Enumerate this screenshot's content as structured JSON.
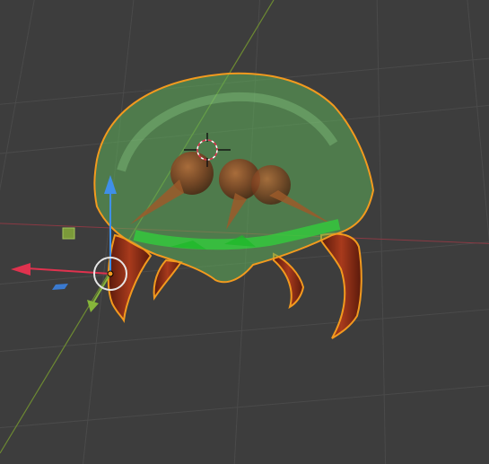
{
  "viewport": {
    "view": "3D Viewport",
    "background_color": "#3d3d3d",
    "grid_color": "#4a4a4a"
  },
  "axes": {
    "x_color": "#e0324e",
    "y_color": "#86b63a",
    "z_color": "#3f8fe8"
  },
  "object": {
    "selected": true,
    "outline_color": "#f39a1e",
    "dome_color": "#5fae5a",
    "limb_color": "#8a2a18"
  },
  "cursor": {
    "icon": "3d-cursor-icon"
  },
  "gizmo": {
    "icon": "transform-gizmo-icon"
  }
}
